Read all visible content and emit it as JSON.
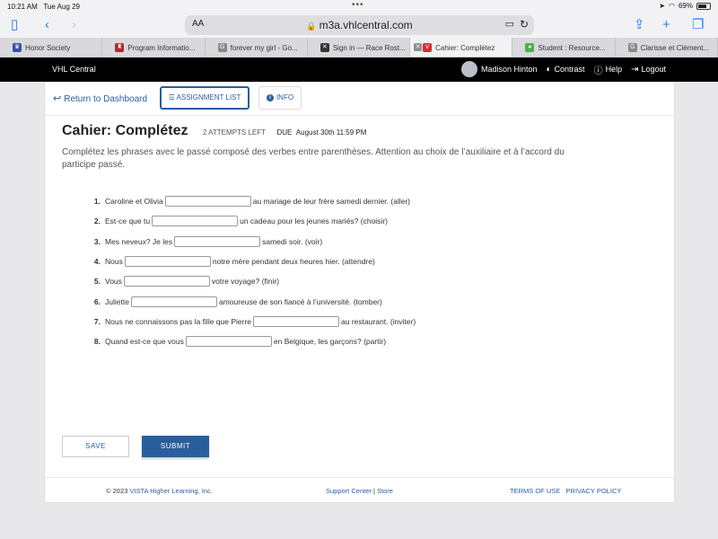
{
  "status_bar": {
    "time": "10:21 AM",
    "date": "Tue Aug 29",
    "battery": "69%"
  },
  "browser": {
    "text_size": "AA",
    "url": "m3a.vhlcentral.com",
    "tabs": [
      {
        "label": "Honor Society",
        "color": "#3b4ea8",
        "glyph": "♛"
      },
      {
        "label": "Program Informatio...",
        "color": "#b3262d",
        "glyph": "♜"
      },
      {
        "label": "forever my girl - Go...",
        "color": "#888888",
        "glyph": "G"
      },
      {
        "label": "Sign in — Race Rost...",
        "color": "#333333",
        "glyph": "✕"
      },
      {
        "label": "Cahier: Complétez",
        "color": "#d32f2f",
        "glyph": "V"
      },
      {
        "label": "Student : Resource...",
        "color": "#4caf50",
        "glyph": "●"
      },
      {
        "label": "Clarisse et Clément...",
        "color": "#888888",
        "glyph": "G"
      }
    ]
  },
  "vhl": {
    "brand": "VHL Central",
    "user": "Madison Hinton",
    "contrast": "Contrast",
    "help": "Help",
    "logout": "Logout"
  },
  "nav": {
    "back": "Return to Dashboard",
    "assignment_list": "ASSIGNMENT LIST",
    "info": "INFO"
  },
  "assignment": {
    "title": "Cahier: Complétez",
    "attempts": "2 ATTEMPTS LEFT",
    "due_label": "DUE",
    "due_date": "August 30th 11:59 PM",
    "instructions": "Complétez les phrases avec le passé composé des verbes entre parenthèses. Attention au choix de l’auxiliaire et à l’accord du participe passé."
  },
  "questions": [
    {
      "num": "1.",
      "before": "Caroline et Olivia",
      "after": "au mariage de leur frère samedi dernier. (aller)"
    },
    {
      "num": "2.",
      "before": "Est-ce que tu",
      "after": "un cadeau pour les jeunes mariés? (choisir)"
    },
    {
      "num": "3.",
      "before": "Mes neveux? Je les",
      "after": "samedi soir. (voir)"
    },
    {
      "num": "4.",
      "before": "Nous",
      "after": "notre mère pendant deux heures hier. (attendre)"
    },
    {
      "num": "5.",
      "before": "Vous",
      "after": "votre voyage? (finir)"
    },
    {
      "num": "6.",
      "before": "Juliette",
      "after": "amoureuse de son fiancé à l’université. (tomber)"
    },
    {
      "num": "7.",
      "before": "Nous ne connaissons pas la fille que Pierre",
      "after": "au restaurant. (inviter)"
    },
    {
      "num": "8.",
      "before": "Quand est-ce que vous",
      "after": "en Belgique, les garçons? (partir)"
    }
  ],
  "actions": {
    "save": "SAVE",
    "submit": "SUBMIT"
  },
  "footer": {
    "copyright": "© 2023",
    "company": "VISTA Higher Learning, Inc.",
    "support": "Support Center",
    "separator": "|",
    "store": "Store",
    "terms": "TERMS OF USE",
    "privacy": "PRIVACY POLICY"
  }
}
